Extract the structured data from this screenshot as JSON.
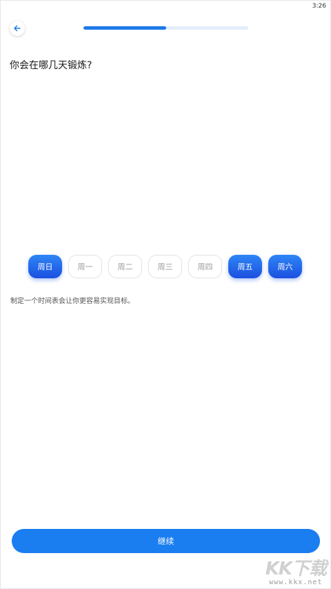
{
  "status_bar": {
    "time": "3:26"
  },
  "header": {
    "back_icon": "arrow-left-icon",
    "progress": 0.5
  },
  "question": "你会在哪几天锻炼?",
  "days": [
    {
      "label": "周日",
      "selected": true
    },
    {
      "label": "周一",
      "selected": false
    },
    {
      "label": "周二",
      "selected": false
    },
    {
      "label": "周三",
      "selected": false
    },
    {
      "label": "周四",
      "selected": false
    },
    {
      "label": "周五",
      "selected": true
    },
    {
      "label": "周六",
      "selected": true
    }
  ],
  "hint": "制定一个时间表会让你更容易实现目标。",
  "continue_label": "继续",
  "watermark": {
    "logo": "KK下载",
    "url": "www.kkx.net"
  },
  "colors": {
    "accent": "#1a7df0",
    "selected_start": "#2f86f5",
    "selected_end": "#1b4fe0"
  }
}
